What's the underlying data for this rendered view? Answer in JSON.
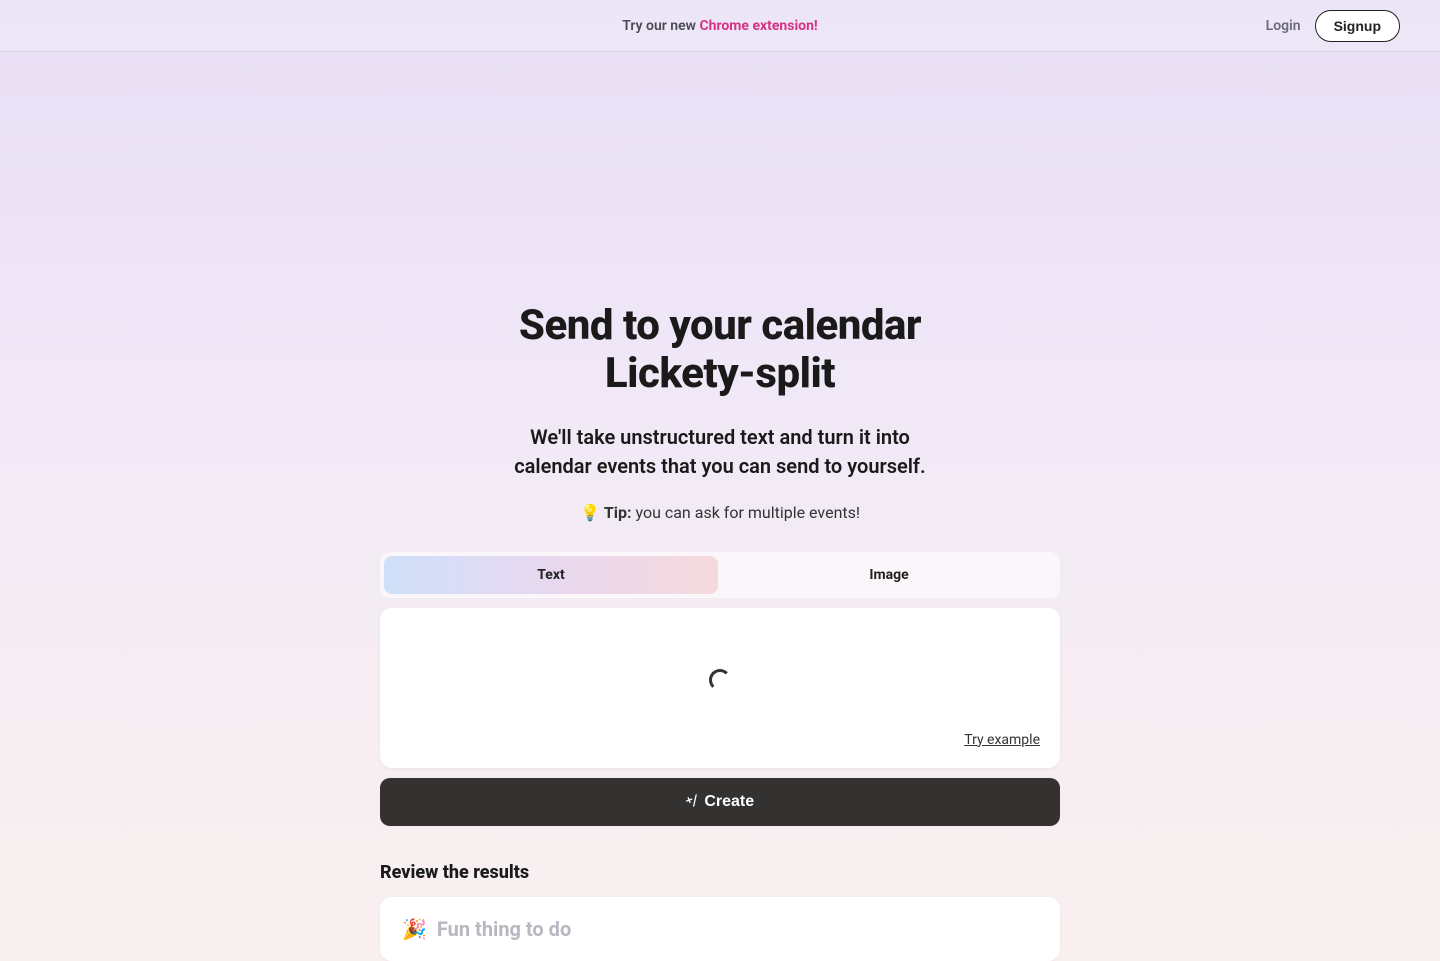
{
  "topbar": {
    "promo_prefix": "Try our new ",
    "promo_highlight": "Chrome extension!",
    "login": "Login",
    "signup": "Signup"
  },
  "hero": {
    "title_line1": "Send to your calendar",
    "title_line2": "Lickety-split",
    "subtitle_line1": "We'll take unstructured text and turn it into",
    "subtitle_line2": "calendar events that you can send to yourself.",
    "tip_emoji": "💡",
    "tip_label": "Tip:",
    "tip_text": " you can ask for multiple events!"
  },
  "tabs": {
    "text": "Text",
    "image": "Image"
  },
  "input": {
    "try_example": "Try example"
  },
  "create": {
    "label": "Create"
  },
  "review": {
    "heading": "Review the results",
    "result_emoji": "🎉",
    "result_title": "Fun thing to do"
  }
}
